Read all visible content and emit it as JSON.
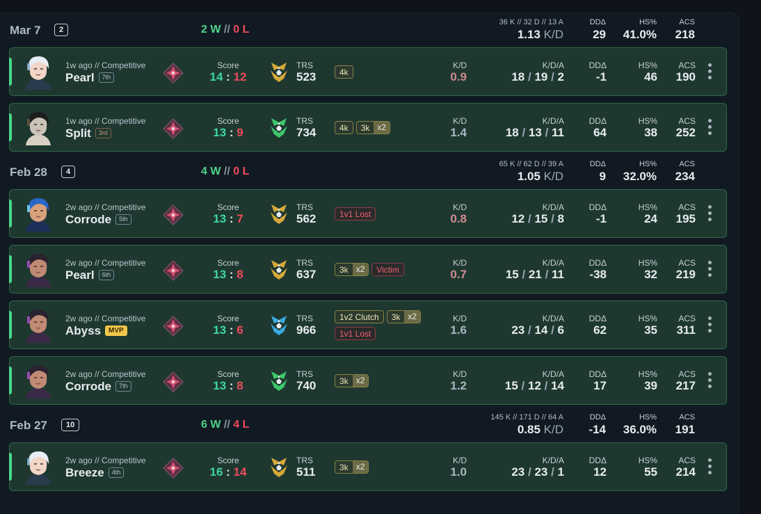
{
  "groups": [
    {
      "date": "Mar 7",
      "count": "2",
      "wins": "2 W",
      "losses": "0 L",
      "kda_summary": "36 K // 32 D // 13 A",
      "kd": "1.13",
      "kd_unit": "K/D",
      "ddd_label": "DDΔ",
      "ddd": "29",
      "hs_label": "HS%",
      "hs": "41.0%",
      "acs_label": "ACS",
      "acs": "218",
      "matches": [
        {
          "meta": "1w ago // Competitive",
          "map": "Pearl",
          "place": "7th",
          "agent": "jett",
          "score_label": "Score",
          "score_a": "14",
          "score_b": "12",
          "score_a_win": true,
          "trs_label": "TRS",
          "trs": "523",
          "trs_color": "#d6a93a",
          "badges": [
            {
              "text": "4k",
              "mult": ""
            }
          ],
          "kd_label": "K/D",
          "kd": "0.9",
          "kd_good": false,
          "kda_label": "K/D/A",
          "k": "18",
          "d": "19",
          "a": "2",
          "ddd_label": "DDΔ",
          "ddd": "-1",
          "hs_label": "HS%",
          "hs": "46",
          "acs_label": "ACS",
          "acs": "190"
        },
        {
          "meta": "1w ago // Competitive",
          "map": "Split",
          "place": "3rd",
          "agent": "cypher",
          "score_label": "Score",
          "score_a": "13",
          "score_b": "9",
          "score_a_win": true,
          "trs_label": "TRS",
          "trs": "734",
          "trs_color": "#3ec86a",
          "badges": [
            {
              "text": "4k",
              "mult": ""
            },
            {
              "text": "3k",
              "mult": "x2"
            }
          ],
          "kd_label": "K/D",
          "kd": "1.4",
          "kd_good": true,
          "kda_label": "K/D/A",
          "k": "18",
          "d": "13",
          "a": "11",
          "ddd_label": "DDΔ",
          "ddd": "64",
          "hs_label": "HS%",
          "hs": "38",
          "acs_label": "ACS",
          "acs": "252"
        }
      ]
    },
    {
      "date": "Feb 28",
      "count": "4",
      "wins": "4 W",
      "losses": "0 L",
      "kda_summary": "65 K // 62 D // 39 A",
      "kd": "1.05",
      "kd_unit": "K/D",
      "ddd_label": "DDΔ",
      "ddd": "9",
      "hs_label": "HS%",
      "hs": "32.0%",
      "acs_label": "ACS",
      "acs": "234",
      "matches": [
        {
          "meta": "2w ago // Competitive",
          "map": "Corrode",
          "place": "5th",
          "agent": "neon",
          "score_label": "Score",
          "score_a": "13",
          "score_b": "7",
          "score_a_win": true,
          "trs_label": "TRS",
          "trs": "562",
          "trs_color": "#d6a93a",
          "badges": [
            {
              "text": "1v1 Lost",
              "mult": "",
              "red": true
            }
          ],
          "kd_label": "K/D",
          "kd": "0.8",
          "kd_good": false,
          "kda_label": "K/D/A",
          "k": "12",
          "d": "15",
          "a": "8",
          "ddd_label": "DDΔ",
          "ddd": "-1",
          "hs_label": "HS%",
          "hs": "24",
          "acs_label": "ACS",
          "acs": "195"
        },
        {
          "meta": "2w ago // Competitive",
          "map": "Pearl",
          "place": "6th",
          "agent": "reyna",
          "score_label": "Score",
          "score_a": "13",
          "score_b": "8",
          "score_a_win": true,
          "trs_label": "TRS",
          "trs": "637",
          "trs_color": "#d6a93a",
          "badges": [
            {
              "text": "3k",
              "mult": "x2"
            },
            {
              "text": "Victim",
              "mult": "",
              "red": true
            }
          ],
          "kd_label": "K/D",
          "kd": "0.7",
          "kd_good": false,
          "kda_label": "K/D/A",
          "k": "15",
          "d": "21",
          "a": "11",
          "ddd_label": "DDΔ",
          "ddd": "-38",
          "hs_label": "HS%",
          "hs": "32",
          "acs_label": "ACS",
          "acs": "219"
        },
        {
          "meta": "2w ago // Competitive",
          "map": "Abyss",
          "place": "",
          "mvp": "MVP",
          "agent": "reyna",
          "score_label": "Score",
          "score_a": "13",
          "score_b": "6",
          "score_a_win": true,
          "trs_label": "TRS",
          "trs": "966",
          "trs_color": "#3aa9e0",
          "badges": [
            {
              "text": "1v2 Clutch",
              "mult": ""
            },
            {
              "text": "3k",
              "mult": "x2"
            },
            {
              "text": "1v1 Lost",
              "mult": "",
              "red": true,
              "newline": true
            }
          ],
          "kd_label": "K/D",
          "kd": "1.6",
          "kd_good": true,
          "kda_label": "K/D/A",
          "k": "23",
          "d": "14",
          "a": "6",
          "ddd_label": "DDΔ",
          "ddd": "62",
          "hs_label": "HS%",
          "hs": "35",
          "acs_label": "ACS",
          "acs": "311"
        },
        {
          "meta": "2w ago // Competitive",
          "map": "Corrode",
          "place": "7th",
          "agent": "reyna",
          "score_label": "Score",
          "score_a": "13",
          "score_b": "8",
          "score_a_win": true,
          "trs_label": "TRS",
          "trs": "740",
          "trs_color": "#3ec86a",
          "badges": [
            {
              "text": "3k",
              "mult": "x2"
            }
          ],
          "kd_label": "K/D",
          "kd": "1.2",
          "kd_good": true,
          "kda_label": "K/D/A",
          "k": "15",
          "d": "12",
          "a": "14",
          "ddd_label": "DDΔ",
          "ddd": "17",
          "hs_label": "HS%",
          "hs": "39",
          "acs_label": "ACS",
          "acs": "217"
        }
      ]
    },
    {
      "date": "Feb 27",
      "count": "10",
      "wins": "6 W",
      "losses": "4 L",
      "kda_summary": "145 K // 171 D // 64 A",
      "kd": "0.85",
      "kd_unit": "K/D",
      "ddd_label": "DDΔ",
      "ddd": "-14",
      "hs_label": "HS%",
      "hs": "36.0%",
      "acs_label": "ACS",
      "acs": "191",
      "matches": [
        {
          "meta": "2w ago // Competitive",
          "map": "Breeze",
          "place": "4th",
          "agent": "jett",
          "score_label": "Score",
          "score_a": "16",
          "score_b": "14",
          "score_a_win": true,
          "trs_label": "TRS",
          "trs": "511",
          "trs_color": "#d6a93a",
          "badges": [
            {
              "text": "3k",
              "mult": "x2"
            }
          ],
          "kd_label": "K/D",
          "kd": "1.0",
          "kd_good": true,
          "kda_label": "K/D/A",
          "k": "23",
          "d": "23",
          "a": "1",
          "ddd_label": "DDΔ",
          "ddd": "12",
          "hs_label": "HS%",
          "hs": "55",
          "acs_label": "ACS",
          "acs": "214"
        }
      ]
    }
  ]
}
